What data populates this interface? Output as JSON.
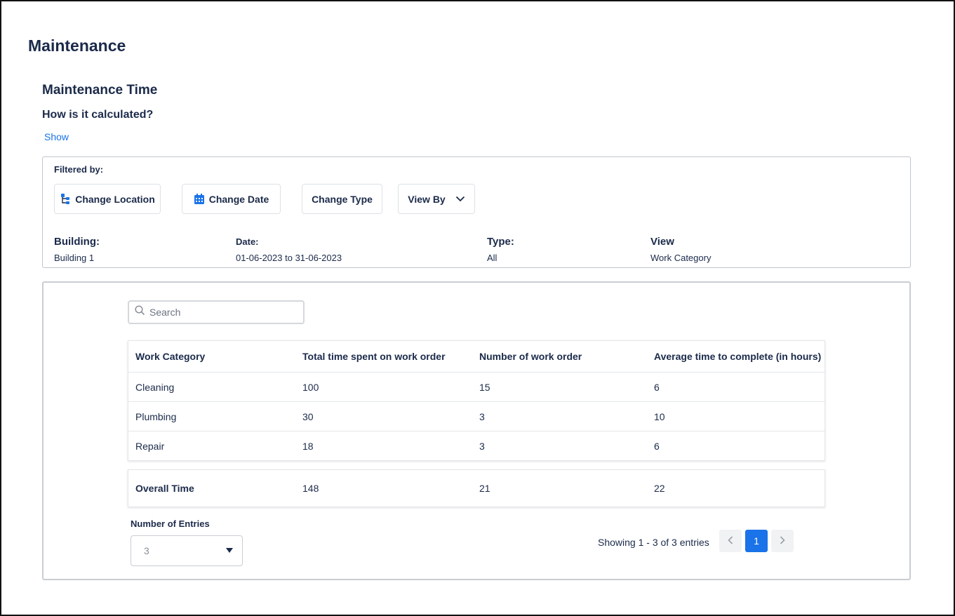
{
  "page": {
    "title": "Maintenance"
  },
  "section": {
    "title": "Maintenance Time",
    "calc_question": "How is it calculated?",
    "show_link": "Show"
  },
  "filters": {
    "label": "Filtered by:",
    "buttons": {
      "change_location": "Change Location",
      "change_date": "Change Date",
      "change_type": "Change Type",
      "view_by": "View By"
    },
    "summary": {
      "building_label": "Building:",
      "building_value": "Building 1",
      "date_label": "Date:",
      "date_value": "01-06-2023 to 31-06-2023",
      "type_label": "Type:",
      "type_value": "All",
      "view_label": "View",
      "view_value": "Work Category"
    }
  },
  "search": {
    "placeholder": "Search"
  },
  "table": {
    "columns": [
      "Work Category",
      "Total time spent on work order",
      "Number of work order",
      "Average time to complete (in hours)"
    ],
    "rows": [
      [
        "Cleaning",
        "100",
        "15",
        "6"
      ],
      [
        "Plumbing",
        "30",
        "3",
        "10"
      ],
      [
        "Repair",
        "18",
        "3",
        "6"
      ]
    ],
    "total": [
      "Overall Time",
      "148",
      "21",
      "22"
    ]
  },
  "entries": {
    "label": "Number of  Entries",
    "selected": "3"
  },
  "pagination": {
    "showing": "Showing 1 - 3 of 3 entries",
    "current_page": "1"
  },
  "colors": {
    "accent": "#1a73e8",
    "text": "#1b2a4a",
    "border": "#c9cdd2"
  }
}
